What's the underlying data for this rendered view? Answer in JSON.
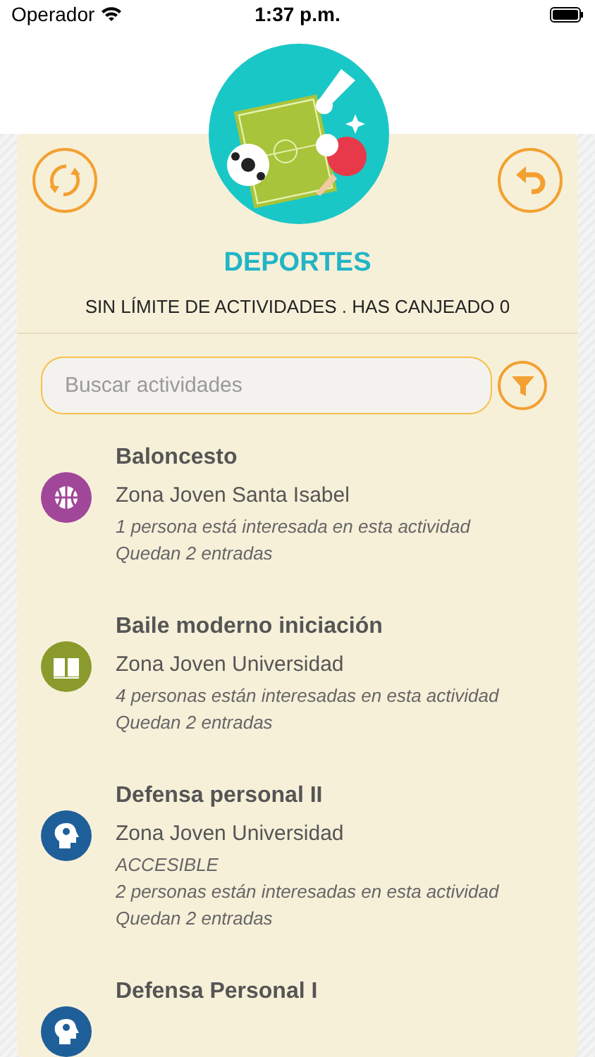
{
  "status_bar": {
    "carrier": "Operador",
    "time": "1:37 p.m."
  },
  "header": {
    "title": "DEPORTES",
    "subtitle": "SIN LÍMITE DE ACTIVIDADES . HAS CANJEADO 0"
  },
  "search": {
    "placeholder": "Buscar actividades"
  },
  "activities": [
    {
      "title": "Baloncesto",
      "kind": "ball",
      "color": "#a0479a",
      "location": "Zona Joven Santa Isabel",
      "details": [
        "1 persona está interesada en esta actividad",
        "Quedan 2 entradas"
      ]
    },
    {
      "title": "Baile moderno iniciación",
      "kind": "book",
      "color": "#8a9a2c",
      "location": "Zona Joven Universidad",
      "details": [
        "4 personas están interesadas en esta actividad",
        "Quedan 2 entradas"
      ]
    },
    {
      "title": "Defensa personal II",
      "kind": "head",
      "color": "#1f5f99",
      "location": "Zona Joven Universidad",
      "details": [
        "ACCESIBLE",
        "2 personas están interesadas en esta actividad",
        "Quedan 2 entradas"
      ]
    },
    {
      "title": "Defensa Personal I",
      "kind": "head",
      "color": "#1f5f99"
    }
  ]
}
